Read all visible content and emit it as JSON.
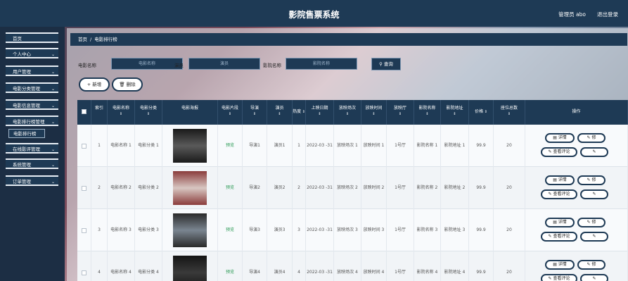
{
  "header": {
    "title": "影院售票系统",
    "user": "管理员 abo",
    "logout": "退出登录"
  },
  "sidebar": {
    "items": [
      {
        "label": "首页",
        "chevron": false
      },
      {
        "label": "个人中心",
        "chevron": true
      },
      {
        "label": "用户管理",
        "chevron": true
      },
      {
        "label": "电影分类管理",
        "chevron": true
      },
      {
        "label": "电影信息管理",
        "chevron": true
      },
      {
        "label": "电影排行榜管理",
        "chevron": true
      },
      {
        "label": "在线影评管理",
        "chevron": true
      },
      {
        "label": "系统管理",
        "chevron": true
      },
      {
        "label": "订单管理",
        "chevron": true
      }
    ],
    "submenu": "电影排行榜"
  },
  "breadcrumb": {
    "home": "首页",
    "sep": "/",
    "current": "电影排行榜"
  },
  "search": {
    "name_label": "电影名称",
    "name_placeholder": "电影名称",
    "actor_label": "演员",
    "actor_placeholder": "演员",
    "cinema_label": "影院名称",
    "cinema_placeholder": "影院名称",
    "query_button": "查询"
  },
  "actions": {
    "add": "+ 新增",
    "delete": "删除"
  },
  "table": {
    "columns": [
      "",
      "索引",
      "电影名称",
      "电影分类",
      "电影海报",
      "电影片段",
      "导演",
      "演员",
      "热度",
      "上映日期",
      "放映场次",
      "放映时间",
      "放映厅",
      "影院名称",
      "影院地址",
      "价格",
      "座位总数",
      "操作"
    ],
    "sortable": [
      false,
      false,
      true,
      true,
      false,
      true,
      true,
      true,
      true,
      true,
      true,
      true,
      true,
      true,
      true,
      true,
      true,
      false
    ],
    "rows": [
      {
        "index": "1",
        "name": "电影名称 1",
        "category": "电影分类 1",
        "clip": "预览",
        "director": "导演1",
        "actor": "演员1",
        "heat": "1",
        "date": "2022-03 -31",
        "session": "放映场次 1",
        "time": "放映时间 1",
        "hall": "1号厅",
        "cinema": "影院名称 1",
        "address": "影院地址 1",
        "price": "99.9",
        "seats": "20"
      },
      {
        "index": "2",
        "name": "电影名称 2",
        "category": "电影分类 2",
        "clip": "预览",
        "director": "导演2",
        "actor": "演员2",
        "heat": "2",
        "date": "2022-03 -31",
        "session": "放映场次 2",
        "time": "放映时间 2",
        "hall": "1号厅",
        "cinema": "影院名称 2",
        "address": "影院地址 2",
        "price": "99.9",
        "seats": "20"
      },
      {
        "index": "3",
        "name": "电影名称 3",
        "category": "电影分类 3",
        "clip": "预览",
        "director": "导演3",
        "actor": "演员3",
        "heat": "3",
        "date": "2022-03 -31",
        "session": "放映场次 3",
        "time": "放映时间 3",
        "hall": "1号厅",
        "cinema": "影院名称 3",
        "address": "影院地址 3",
        "price": "99.9",
        "seats": "20"
      },
      {
        "index": "4",
        "name": "电影名称 4",
        "category": "电影分类 4",
        "clip": "预览",
        "director": "导演4",
        "actor": "演员4",
        "heat": "4",
        "date": "2022-03 -31",
        "session": "放映场次 4",
        "time": "放映时间 4",
        "hall": "1号厅",
        "cinema": "影院名称 4",
        "address": "影院地址 4",
        "price": "99.9",
        "seats": "20"
      }
    ],
    "row_actions": {
      "detail": "详情",
      "edit": "修",
      "review": "查看评论"
    }
  }
}
